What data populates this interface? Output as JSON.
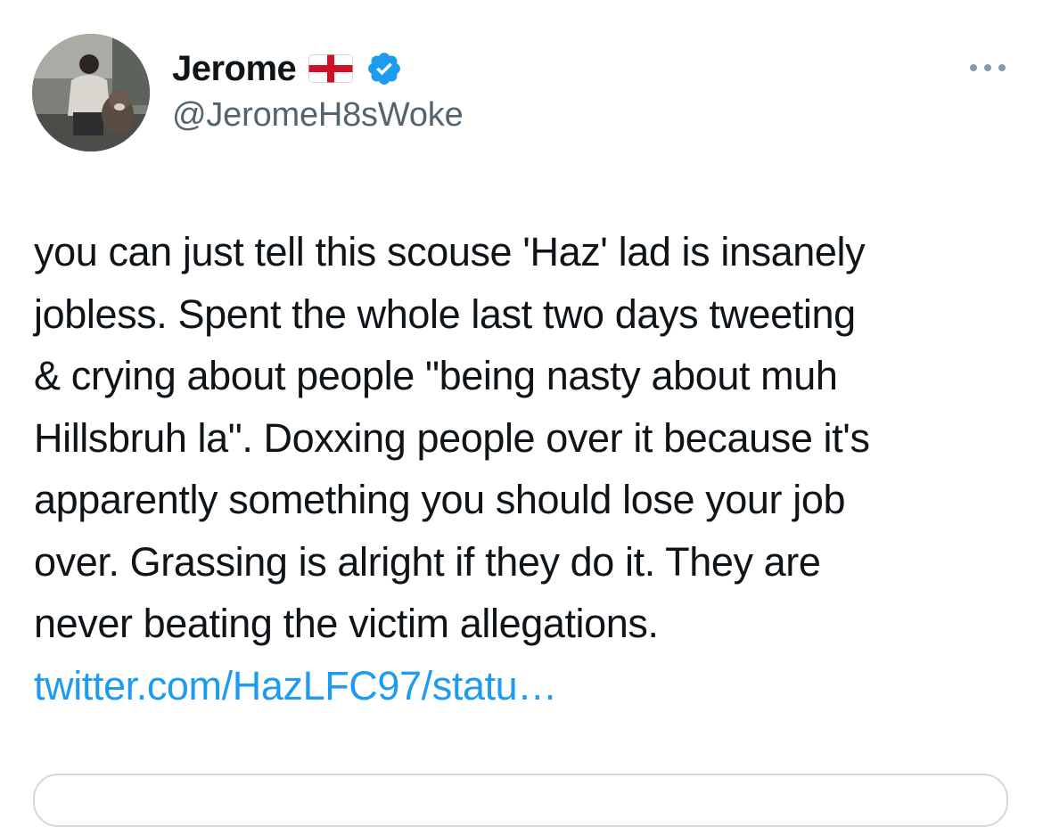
{
  "author": {
    "display_name": "Jerome",
    "handle": "@JeromeH8sWoke",
    "flag_icon": "england-flag-icon",
    "verified_icon": "verified-badge-icon",
    "verified_color": "#1d9bf0"
  },
  "tweet": {
    "text_lines": [
      "you can just tell this scouse 'Haz' lad is insanely",
      "jobless. Spent the whole last two days tweeting",
      "& crying about people \"being nasty about muh",
      "Hillsbruh la\". Doxxing people over it because it's",
      "apparently something you should lose your job",
      "over. Grassing is alright if they do it. They are",
      "never beating the victim allegations."
    ],
    "link": "twitter.com/HazLFC97/statu…"
  },
  "menu": {
    "icon": "more-options-icon"
  },
  "colors": {
    "text": "#0f1419",
    "secondary": "#536471",
    "link": "#1d9bf0",
    "border": "#cfd9de"
  }
}
